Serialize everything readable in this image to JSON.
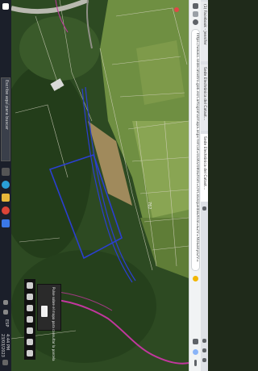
{
  "taskbar": {
    "search_placeholder": "Escribe aquí para buscar",
    "clock_time": "4:44 PM",
    "clock_date": "23/03/2023",
    "language": "ESP"
  },
  "browser": {
    "tab1_title": "(1) Facebook - Jennifer",
    "tab2_title": "Sede Electrónica del Catast...",
    "tab3_title": "Sede Electrónica del Catast...",
    "address_url": "https://www1.sedecatastro.gob.es/Cartografia/mapa.aspx?refcat=01802080&from=OVCBusqueda&final=&ZV=NO&anyoZV=",
    "page_title": "Sede Electrónica del Catastro"
  },
  "map": {
    "parcel_label": "762",
    "parcel_outline_color": "#2b3fd1",
    "road_color": "#c2379e",
    "panel_text": "Pulse sobre el mapa para consultar la parcela"
  }
}
